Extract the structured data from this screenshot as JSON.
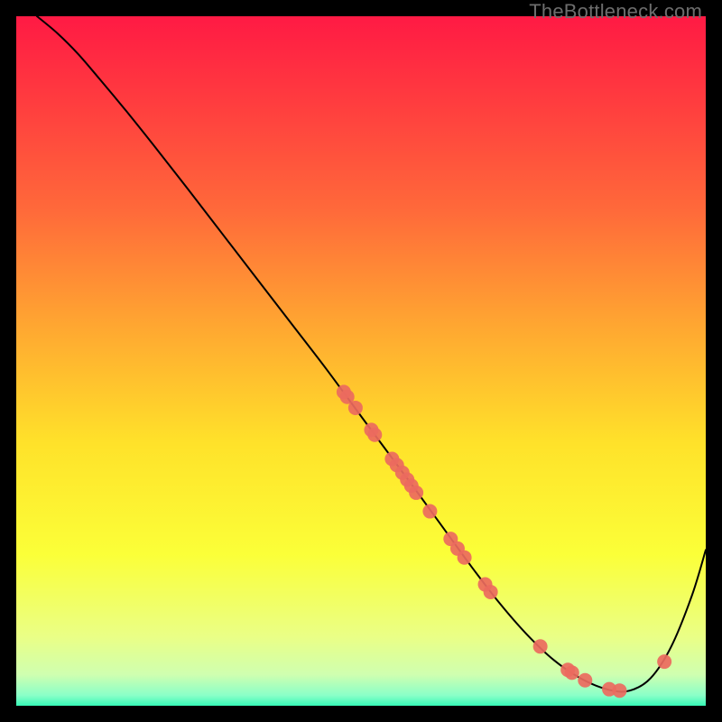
{
  "watermark": "TheBottleneck.com",
  "chart_data": {
    "type": "line",
    "title": "",
    "xlabel": "",
    "ylabel": "",
    "xlim": [
      0,
      1
    ],
    "ylim": [
      0,
      1
    ],
    "grid": false,
    "legend": false,
    "background": {
      "kind": "vertical-gradient",
      "stops": [
        {
          "pos": 0.0,
          "color": "#ff1a44"
        },
        {
          "pos": 0.12,
          "color": "#ff3b3f"
        },
        {
          "pos": 0.28,
          "color": "#ff693a"
        },
        {
          "pos": 0.45,
          "color": "#ffa731"
        },
        {
          "pos": 0.62,
          "color": "#ffe22a"
        },
        {
          "pos": 0.78,
          "color": "#fbff38"
        },
        {
          "pos": 0.9,
          "color": "#eaff86"
        },
        {
          "pos": 0.955,
          "color": "#cfffb0"
        },
        {
          "pos": 0.985,
          "color": "#8affc8"
        },
        {
          "pos": 1.0,
          "color": "#36f9b6"
        }
      ]
    },
    "series": [
      {
        "name": "bottleneck-curve",
        "color": "#000000",
        "stroke_width": 2,
        "x": [
          0.03,
          0.06,
          0.09,
          0.12,
          0.16,
          0.2,
          0.25,
          0.3,
          0.35,
          0.4,
          0.45,
          0.5,
          0.54,
          0.58,
          0.62,
          0.66,
          0.7,
          0.74,
          0.78,
          0.82,
          0.86,
          0.89,
          0.92,
          0.95,
          0.98,
          1.0
        ],
        "y": [
          1.0,
          0.975,
          0.945,
          0.91,
          0.862,
          0.812,
          0.748,
          0.683,
          0.618,
          0.553,
          0.488,
          0.42,
          0.366,
          0.312,
          0.257,
          0.202,
          0.15,
          0.104,
          0.066,
          0.039,
          0.023,
          0.022,
          0.04,
          0.086,
          0.16,
          0.226
        ]
      }
    ],
    "scatter": [
      {
        "name": "highlighted-points",
        "color": "#ec6a5e",
        "radius": 8,
        "points": [
          {
            "x": 0.475,
            "y": 0.455
          },
          {
            "x": 0.48,
            "y": 0.448
          },
          {
            "x": 0.492,
            "y": 0.432
          },
          {
            "x": 0.515,
            "y": 0.4
          },
          {
            "x": 0.52,
            "y": 0.393
          },
          {
            "x": 0.545,
            "y": 0.358
          },
          {
            "x": 0.552,
            "y": 0.349
          },
          {
            "x": 0.56,
            "y": 0.338
          },
          {
            "x": 0.567,
            "y": 0.328
          },
          {
            "x": 0.573,
            "y": 0.319
          },
          {
            "x": 0.58,
            "y": 0.309
          },
          {
            "x": 0.6,
            "y": 0.282
          },
          {
            "x": 0.63,
            "y": 0.242
          },
          {
            "x": 0.64,
            "y": 0.228
          },
          {
            "x": 0.65,
            "y": 0.215
          },
          {
            "x": 0.68,
            "y": 0.176
          },
          {
            "x": 0.688,
            "y": 0.165
          },
          {
            "x": 0.76,
            "y": 0.086
          },
          {
            "x": 0.8,
            "y": 0.052
          },
          {
            "x": 0.806,
            "y": 0.048
          },
          {
            "x": 0.825,
            "y": 0.037
          },
          {
            "x": 0.86,
            "y": 0.024
          },
          {
            "x": 0.875,
            "y": 0.022
          },
          {
            "x": 0.94,
            "y": 0.064
          }
        ]
      }
    ]
  }
}
